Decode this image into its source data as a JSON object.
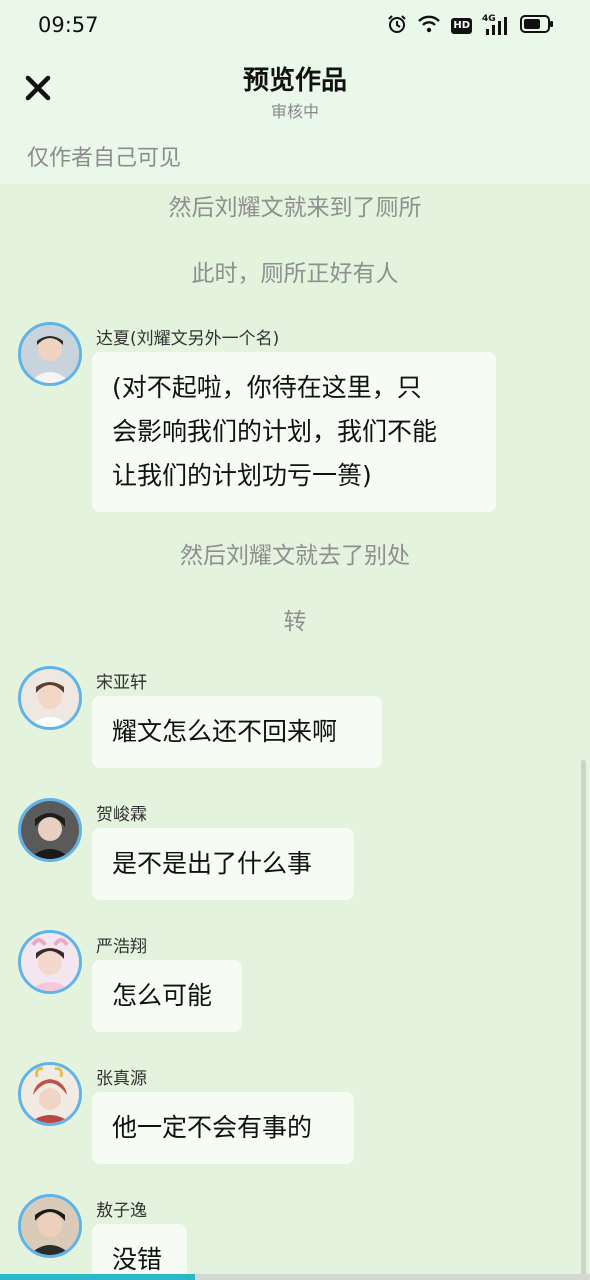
{
  "status_bar": {
    "time": "09:57",
    "network_type": "4G",
    "hd_label": "HD",
    "icons": [
      "alarm-icon",
      "wifi-icon",
      "hd-icon",
      "signal-icon",
      "battery-icon"
    ]
  },
  "header": {
    "title": "预览作品",
    "subtitle": "审核中",
    "visibility_note": "仅作者自己可见",
    "close_icon": "close-icon"
  },
  "chat": {
    "narration_1": "然后刘耀文就来到了厕所",
    "narration_2": "此时，厕所正好有人",
    "messages": [
      {
        "sender": "达夏(刘耀文另外一个名)",
        "lines": [
          "(对不起啦，你待在这里，只",
          "会影响我们的计划，我们不能",
          "让我们的计划功亏一篑)"
        ]
      },
      {
        "sender": "宋亚轩",
        "text": "耀文怎么还不回来啊"
      },
      {
        "sender": "贺峻霖",
        "text": "是不是出了什么事"
      },
      {
        "sender": "严浩翔",
        "text": "怎么可能"
      },
      {
        "sender": "张真源",
        "text": "他一定不会有事的"
      },
      {
        "sender": "敖子逸",
        "text": "没错"
      }
    ],
    "narration_3": "然后刘耀文就去了别处",
    "narration_4": "转"
  },
  "colors": {
    "background": "#e3f3dd",
    "header_bg": "#eaf8ea",
    "bubble_bg": "#f6fbf3",
    "avatar_ring": "#5fb2ea",
    "progress": "#2ab7c8"
  },
  "progress": {
    "fraction": 0.33
  }
}
